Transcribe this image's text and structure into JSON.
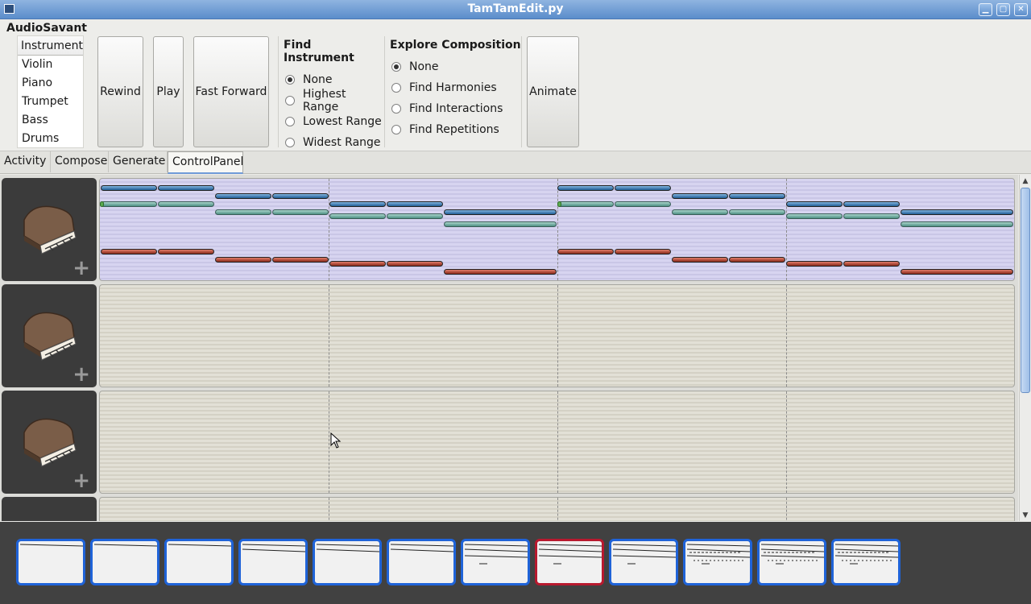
{
  "window": {
    "title": "TamTamEdit.py"
  },
  "toolbar": {
    "app_name": "AudioSavant",
    "instrument_header": "Instrument",
    "instruments": [
      "Violin",
      "Piano",
      "Trumpet",
      "Bass",
      "Drums"
    ],
    "rewind_label": "Rewind",
    "play_label": "Play",
    "fast_forward_label": "Fast Forward",
    "find_instrument": {
      "title": "Find Instrument",
      "options": [
        "None",
        "Highest Range",
        "Lowest Range",
        "Widest Range"
      ],
      "selected": "None"
    },
    "explore_composition": {
      "title": "Explore Composition",
      "options": [
        "None",
        "Find Harmonies",
        "Find Interactions",
        "Find Repetitions"
      ],
      "selected": "None"
    },
    "animate_label": "Animate"
  },
  "tabs": [
    {
      "label": "Activity",
      "active": false
    },
    {
      "label": "Compose",
      "active": false
    },
    {
      "label": "Generate",
      "active": false
    },
    {
      "label": "ControlPanel",
      "active": true
    }
  ],
  "tracks": [
    {
      "instrument_icon": "piano-icon",
      "add_icon": "plus-icon",
      "active": true
    },
    {
      "instrument_icon": "piano-icon",
      "add_icon": "plus-icon",
      "active": false
    },
    {
      "instrument_icon": "piano-icon",
      "add_icon": "plus-icon",
      "active": false
    },
    {
      "instrument_icon": "piano-icon",
      "add_icon": "plus-icon",
      "active": false
    }
  ],
  "pages": {
    "count": 12,
    "selected_index": 7
  },
  "colors": {
    "accent": "#1f63d8",
    "selected_page": "#b8192e",
    "titlebar": "#5b8dcb"
  }
}
